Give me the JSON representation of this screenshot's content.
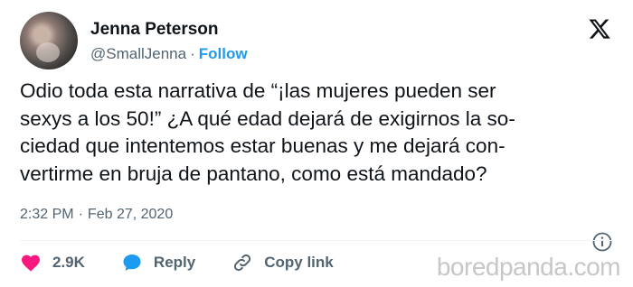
{
  "author": {
    "name": "Jenna Peterson",
    "handle": "@SmallJenna",
    "separator": "·",
    "follow_label": "Follow"
  },
  "tweet": {
    "text": "Odio toda esta narrativa de “¡las mujeres pueden ser sexys a los 50!” ¿A qué edad dejará de exigirnos la so-ciedad que intentemos estar buenas y me dejará con-vertirme en bruja de pantano, como está mandado?",
    "lines": [
      "Odio toda esta narrativa de “¡las mujeres pueden ser",
      "sexys a los 50!” ¿A qué edad dejará de exigirnos la so-",
      "ciedad que intentemos estar buenas y me dejará con-",
      "vertirme en bruja de pantano, como está mandado?"
    ],
    "time": "2:32 PM",
    "date": "Feb 27, 2020",
    "separator": "·"
  },
  "actions": {
    "like_count": "2.9K",
    "reply_label": "Reply",
    "copy_link_label": "Copy link"
  },
  "icons": {
    "platform": "x-logo-icon",
    "info": "info-icon",
    "like": "heart-icon",
    "reply": "speech-bubble-icon",
    "copy_link": "link-icon"
  },
  "colors": {
    "like": "#f91880",
    "reply": "#1d9bf0",
    "link_accent": "#1d9bf0",
    "secondary_text": "#536471"
  },
  "watermark": "boredpanda.com"
}
